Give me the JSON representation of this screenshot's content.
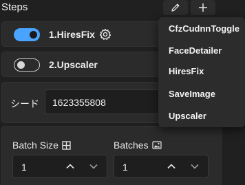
{
  "header": {
    "title": "Steps",
    "edit_icon": "pencil-icon",
    "add_icon": "plus-icon"
  },
  "steps": [
    {
      "label": "1.HiresFix",
      "enabled": true
    },
    {
      "label": "2.Upscaler",
      "enabled": false
    }
  ],
  "seed": {
    "label": "シード",
    "value": "1623355808"
  },
  "batch": {
    "batch_size_label": "Batch Size",
    "batch_size_value": "1",
    "batches_label": "Batches",
    "batches_value": "1"
  },
  "menu": {
    "items": [
      "CfzCudnnToggle",
      "FaceDetailer",
      "HiresFix",
      "SaveImage",
      "Upscaler"
    ]
  },
  "colors": {
    "accent": "#4aa3ff",
    "background": "#202020",
    "card": "#2b2b2b"
  }
}
